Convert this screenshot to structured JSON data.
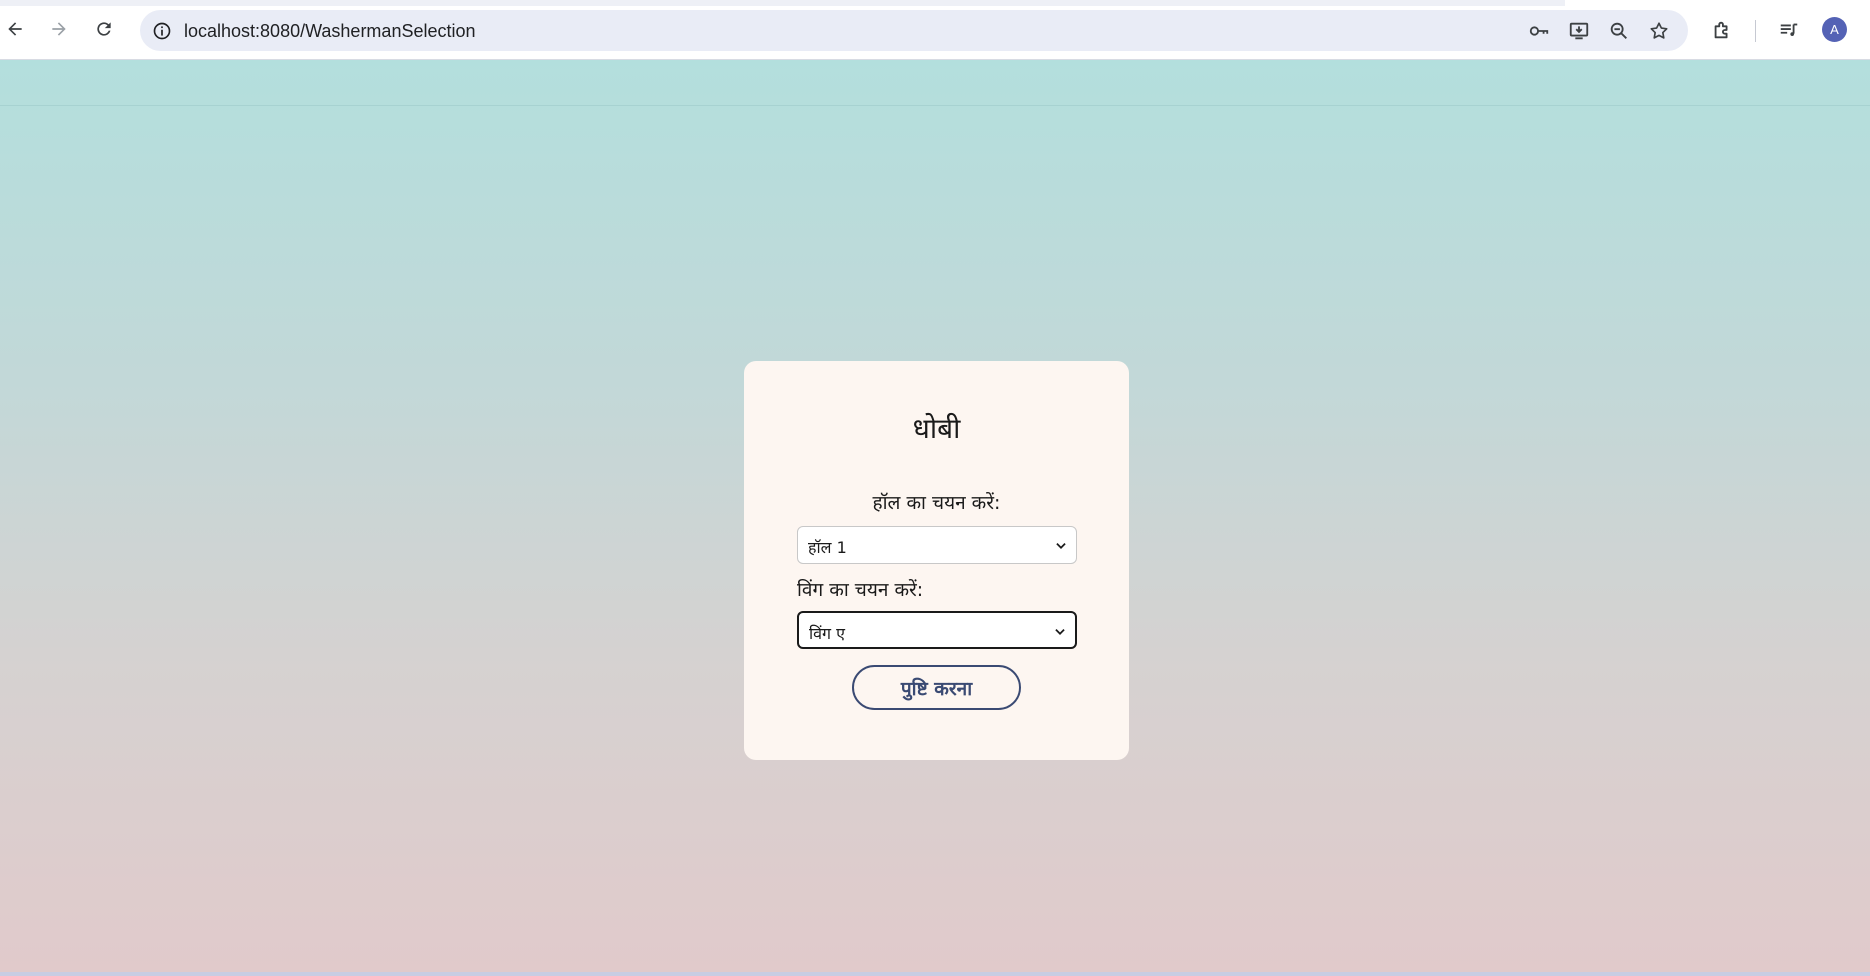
{
  "browser": {
    "url": "localhost:8080/WashermanSelection",
    "avatar_initial": "A",
    "icons": [
      "back-arrow-icon",
      "forward-arrow-icon",
      "reload-icon",
      "site-info-icon",
      "password-key-icon",
      "install-app-icon",
      "zoom-out-icon",
      "bookmark-star-icon",
      "extensions-icon",
      "reading-list-icon"
    ]
  },
  "card": {
    "title": "धोबी",
    "hall_label": "हॉल का चयन करें:",
    "hall_selected": "हॉल 1",
    "wing_label": "विंग का चयन करें:",
    "wing_selected": "विंग ए",
    "confirm_label": "पुष्टि करना"
  },
  "colors": {
    "accent": "#3a4a73",
    "card_bg": "#fdf6f1",
    "gradient_top": "#b3dfdd",
    "gradient_bottom": "#e1cacb"
  }
}
